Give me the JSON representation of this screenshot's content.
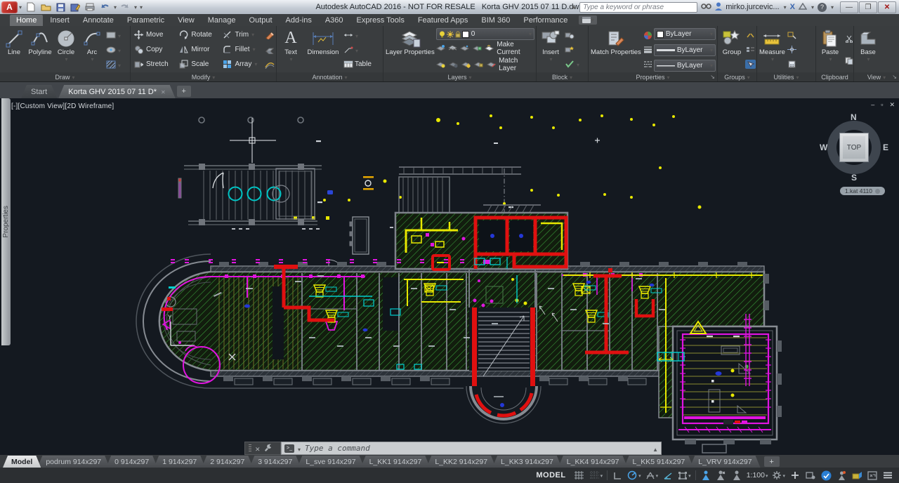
{
  "titlebar": {
    "logo_letter": "A",
    "app_title": "Autodesk AutoCAD 2016 - NOT FOR RESALE",
    "doc_title": "Korta GHV 2015 07 11 D.dwg",
    "search_placeholder": "Type a keyword or phrase",
    "user": "mirko.jurcevic...",
    "exchange": "X",
    "help": "?"
  },
  "ribbon": {
    "tabs": [
      {
        "label": "Home"
      },
      {
        "label": "Insert"
      },
      {
        "label": "Annotate"
      },
      {
        "label": "Parametric"
      },
      {
        "label": "View"
      },
      {
        "label": "Manage"
      },
      {
        "label": "Output"
      },
      {
        "label": "Add-ins"
      },
      {
        "label": "A360"
      },
      {
        "label": "Express Tools"
      },
      {
        "label": "Featured Apps"
      },
      {
        "label": "BIM 360"
      },
      {
        "label": "Performance"
      }
    ],
    "draw": {
      "title": "Draw",
      "line": "Line",
      "polyline": "Polyline",
      "circle": "Circle",
      "arc": "Arc"
    },
    "modify": {
      "title": "Modify",
      "move": "Move",
      "rotate": "Rotate",
      "trim": "Trim",
      "copy": "Copy",
      "mirror": "Mirror",
      "fillet": "Fillet",
      "stretch": "Stretch",
      "scale": "Scale",
      "array": "Array"
    },
    "annotation": {
      "title": "Annotation",
      "text": "Text",
      "text_icon": "A",
      "dimension": "Dimension",
      "table": "Table"
    },
    "layers": {
      "title": "Layers",
      "big": "Layer Properties",
      "current_layer": "0",
      "make_current": "Make Current",
      "match_layer": "Match Layer"
    },
    "block": {
      "title": "Block",
      "insert": "Insert"
    },
    "properties": {
      "title": "Properties",
      "match": "Match Properties",
      "color": "ByLayer",
      "linetype": "ByLayer",
      "lineweight": "ByLayer"
    },
    "groups": {
      "title": "Groups",
      "group": "Group"
    },
    "utilities": {
      "title": "Utilities",
      "measure": "Measure"
    },
    "clipboard": {
      "title": "Clipboard",
      "paste": "Paste"
    },
    "view": {
      "title": "View",
      "base": "Base"
    }
  },
  "filetabs": {
    "start": "Start",
    "doc": "Korta GHV 2015 07 11 D*"
  },
  "drawing": {
    "viewport_label": "[-][Custom View][2D Wireframe]",
    "palette_tab": "Properties",
    "viewcube": {
      "n": "N",
      "e": "E",
      "s": "S",
      "w": "W",
      "top": "TOP",
      "level": "1.kat 4110"
    }
  },
  "command": {
    "placeholder": "Type a command"
  },
  "layout_tabs": [
    {
      "label": "Model"
    },
    {
      "label": "podrum 914x297"
    },
    {
      "label": "0 914x297"
    },
    {
      "label": "1 914x297"
    },
    {
      "label": "2 914x297"
    },
    {
      "label": "3 914x297"
    },
    {
      "label": "L_sve 914x297"
    },
    {
      "label": "L_KK1 914x297"
    },
    {
      "label": "L_KK2 914x297"
    },
    {
      "label": "L_KK3 914x297"
    },
    {
      "label": "L_KK4 914x297"
    },
    {
      "label": "L_KK5 914x297"
    },
    {
      "label": "L_VRV 914x297"
    }
  ],
  "statusbar": {
    "model": "MODEL",
    "scale": "1:100"
  },
  "colors": {
    "accent_red": "#e01010",
    "hatch_green": "#3aa33a",
    "mep_yellow": "#e8e800",
    "pipe_magenta": "#e014e0",
    "label_cyan": "#00cfcf"
  }
}
